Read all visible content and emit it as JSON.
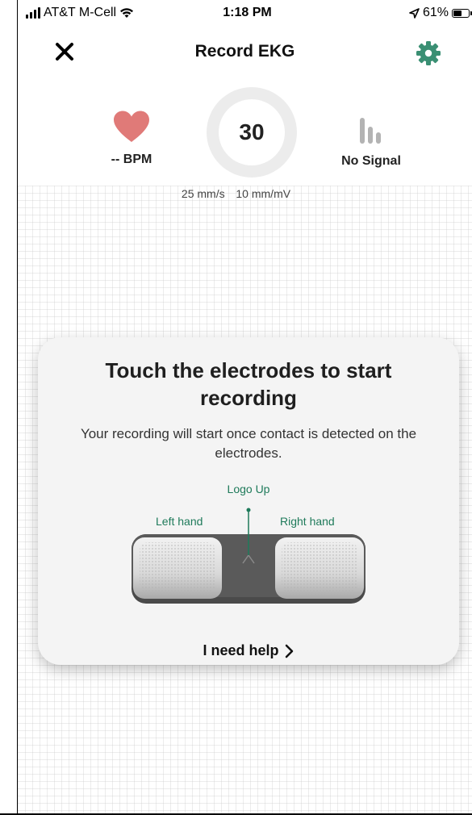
{
  "status_bar": {
    "carrier": "AT&T M-Cell",
    "time": "1:18 PM",
    "battery": "61%",
    "battery_level": 0.61
  },
  "nav": {
    "title": "Record EKG",
    "close_icon": "close-icon",
    "settings_icon": "gear-icon",
    "accent_color": "#3a8f73"
  },
  "metrics": {
    "bpm_label": "-- BPM",
    "timer": "30",
    "signal_label": "No Signal",
    "heart_color": "#e07a78"
  },
  "scale": {
    "speed": "25 mm/s",
    "gain": "10 mm/mV"
  },
  "card": {
    "title": "Touch the electrodes to start recording",
    "description": "Your recording will start once contact is detected on the electrodes.",
    "logo_up": "Logo Up",
    "left_hand": "Left hand",
    "right_hand": "Right hand",
    "help": "I need help"
  }
}
